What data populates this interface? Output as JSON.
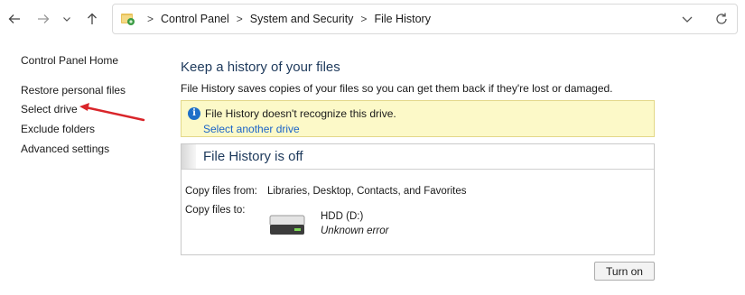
{
  "navigation": {
    "back_icon": "arrow-left-icon",
    "forward_icon": "arrow-right-icon",
    "recent_icon": "chevron-down-icon",
    "up_icon": "arrow-up-icon"
  },
  "address_bar": {
    "location_icon": "control-panel-icon",
    "breadcrumbs": [
      "Control Panel",
      "System and Security",
      "File History"
    ],
    "dropdown_icon": "chevron-down-icon",
    "refresh_icon": "refresh-icon"
  },
  "left_pane": {
    "home": "Control Panel Home",
    "links": [
      "Restore personal files",
      "Select drive",
      "Exclude folders",
      "Advanced settings"
    ]
  },
  "annotation": {
    "arrow_color": "#d9252a"
  },
  "main": {
    "title": "Keep a history of your files",
    "description": "File History saves copies of your files so you can get them back if they're lost or damaged.",
    "warning": {
      "text": "File History doesn't recognize this drive.",
      "link": "Select another drive",
      "icon": "info-icon",
      "background": "#fcf9c8"
    },
    "status": {
      "title": "File History is off",
      "copy_from_label": "Copy files from:",
      "copy_from_value": "Libraries, Desktop, Contacts, and Favorites",
      "copy_to_label": "Copy files to:",
      "drive_icon": "hard-drive-icon",
      "drive_name": "HDD (D:)",
      "drive_status": "Unknown error"
    },
    "turn_on_button": "Turn on"
  },
  "colors": {
    "title_blue": "#1e3a5c",
    "link_blue": "#1a64c8"
  }
}
